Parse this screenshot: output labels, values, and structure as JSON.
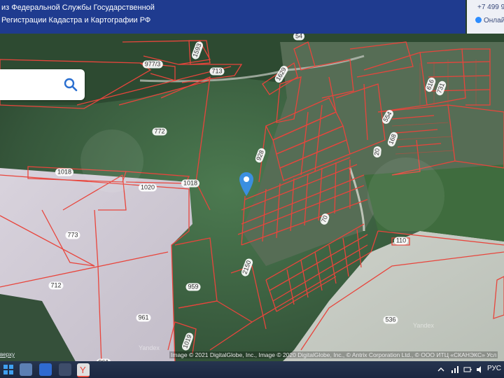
{
  "banner": {
    "line1": "из Федеральной Службы Государственной",
    "line2": "Регистрации Кадастра и Картографии РФ"
  },
  "contact": {
    "phone": "+7 499 9",
    "online": "Онлайн"
  },
  "search": {
    "value": "",
    "placeholder": ""
  },
  "map": {
    "parcels": [
      {
        "id": "p977",
        "label": "977/3"
      },
      {
        "id": "p1593",
        "label": "1593"
      },
      {
        "id": "p713",
        "label": "713"
      },
      {
        "id": "p1629",
        "label": "1629"
      },
      {
        "id": "p54",
        "label": "54"
      },
      {
        "id": "p772",
        "label": "772"
      },
      {
        "id": "p1018a",
        "label": "1018"
      },
      {
        "id": "p1018b",
        "label": "1018"
      },
      {
        "id": "p1020",
        "label": "1020"
      },
      {
        "id": "p928",
        "label": "928"
      },
      {
        "id": "p773",
        "label": "773"
      },
      {
        "id": "p712",
        "label": "712"
      },
      {
        "id": "p959",
        "label": "959"
      },
      {
        "id": "p961",
        "label": "961"
      },
      {
        "id": "p2150",
        "label": "2150"
      },
      {
        "id": "p536",
        "label": "536"
      },
      {
        "id": "p110",
        "label": "110"
      },
      {
        "id": "p554",
        "label": "554"
      },
      {
        "id": "p20",
        "label": "20"
      },
      {
        "id": "p168",
        "label": "168"
      },
      {
        "id": "p616",
        "label": "616"
      },
      {
        "id": "p731",
        "label": "731"
      },
      {
        "id": "p1019",
        "label": "1019"
      },
      {
        "id": "p70",
        "label": "70"
      },
      {
        "id": "p961b",
        "label": "961"
      }
    ],
    "attribution": "Image © 2021 DigitalGlobe, Inc., Image © 2020 DigitalGlobe, Inc., © Antrix Corporation Ltd., © ООО ИТЦ «СКАНЭКС»",
    "attribution_tail": "Усл",
    "watermark": "Yandex",
    "left_link": "верху"
  },
  "taskbar": {
    "lang": "РУС"
  },
  "colors": {
    "parcel_border": "#e8453c",
    "banner_bg": "#1f3b8f",
    "marker": "#3b8fe0"
  }
}
